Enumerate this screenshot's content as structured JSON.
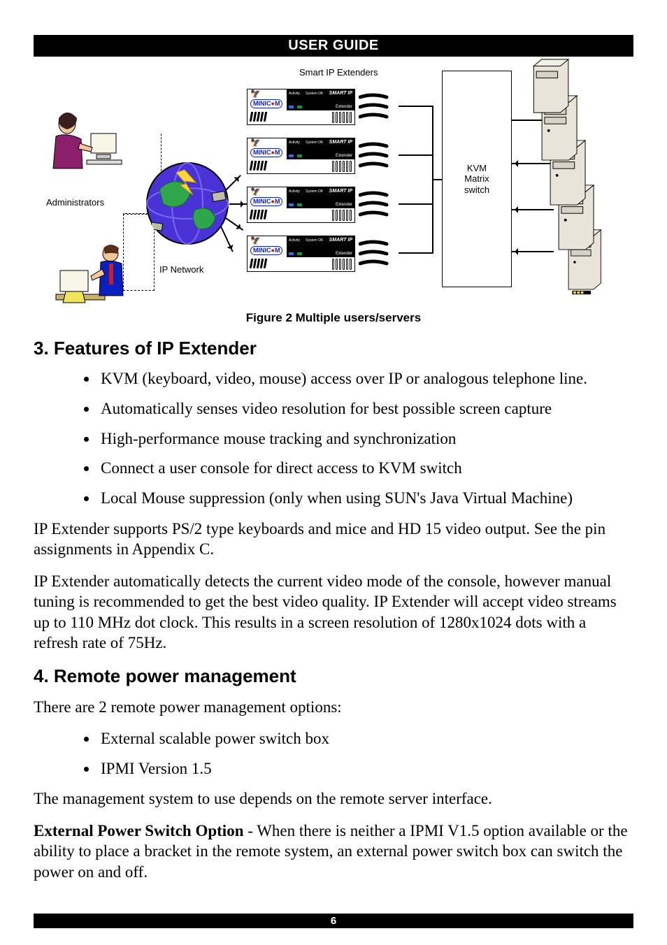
{
  "header": {
    "title": "USER GUIDE"
  },
  "footer": {
    "page_number": "6"
  },
  "diagram": {
    "top_label": "Smart IP Extenders",
    "admin_label": "Administrators",
    "ip_label": "IP Network",
    "kvm_label": "KVM\nMatrix\nswitch",
    "extender": {
      "brand": "MINIC",
      "brand_dot": "●",
      "brand_m": "M",
      "activity": "Activity",
      "system": "System OK",
      "smart_ip": "SMART IP",
      "extender_text": "Extender"
    }
  },
  "caption": "Figure 2 Multiple users/servers",
  "section3": {
    "heading": "3. Features of IP Extender",
    "bullets": [
      "KVM (keyboard, video, mouse) access over IP or analogous telephone line.",
      "Automatically senses video resolution for best possible screen capture",
      "High-performance mouse tracking and synchronization",
      "Connect a user console for direct access to KVM switch",
      "Local Mouse suppression (only when using SUN's Java Virtual Machine)"
    ],
    "para1": "IP Extender supports PS/2 type keyboards and mice and HD 15 video output. See the pin assignments in Appendix C.",
    "para2": "IP Extender automatically detects the current video mode of the console, however manual tuning is recommended to get the best video quality. IP Extender will accept video streams up to 110 MHz dot clock. This results in a screen resolution of 1280x1024 dots with a refresh rate of 75Hz."
  },
  "section4": {
    "heading": "4. Remote power management",
    "intro": "There are 2 remote power management options:",
    "bullets": [
      "External scalable power switch box",
      "IPMI Version 1.5"
    ],
    "para1": "The management system to use depends on the remote server interface.",
    "para2_bold": "External Power Switch Option",
    "para2_rest": " - When there is neither a IPMI V1.5 option available or the ability to place a bracket in the remote system, an external power switch box can switch the power on and off."
  }
}
